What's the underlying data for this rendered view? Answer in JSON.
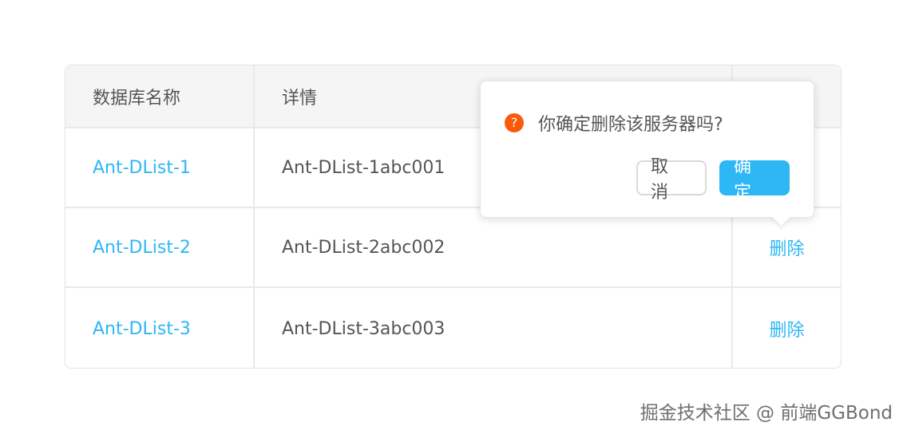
{
  "table": {
    "headers": [
      "数据库名称",
      "详情",
      ""
    ],
    "rows": [
      {
        "name": "Ant-DList-1",
        "detail": "Ant-DList-1abc001",
        "action": ""
      },
      {
        "name": "Ant-DList-2",
        "detail": "Ant-DList-2abc002",
        "action": "删除"
      },
      {
        "name": "Ant-DList-3",
        "detail": "Ant-DList-3abc003",
        "action": "删除"
      }
    ]
  },
  "popconfirm": {
    "icon": "question-circle-icon",
    "icon_glyph": "?",
    "message": "你确定删除该服务器吗?",
    "cancel_label": "取消",
    "ok_label": "确定"
  },
  "watermark": "掘金技术社区 @ 前端GGBond",
  "colors": {
    "link": "#2db7f5",
    "primary": "#2db7f5",
    "warning": "#fa5a0a",
    "header_bg": "#f5f5f5"
  }
}
